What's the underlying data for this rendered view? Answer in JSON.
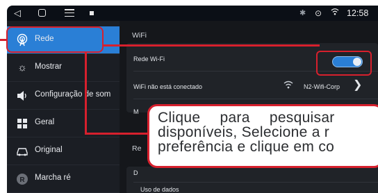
{
  "status_bar": {
    "back_icon": "triangle-back-icon",
    "home_icon": "square-home-icon",
    "menu_icon": "menu-icon",
    "bluetooth_icon": "bluetooth-icon",
    "location_icon": "location-pin-icon",
    "wifi_icon": "wifi-icon",
    "time": "12:58"
  },
  "sidebar": {
    "items": [
      {
        "label": "Rede",
        "icon": "wifi-antenna-icon",
        "active": true
      },
      {
        "label": "Mostrar",
        "icon": "sun-brightness-icon",
        "active": false
      },
      {
        "label": "Configuração de som",
        "icon": "speaker-icon",
        "active": false
      },
      {
        "label": "Geral",
        "icon": "grid-icon",
        "active": false
      },
      {
        "label": "Original",
        "icon": "car-icon",
        "active": false
      },
      {
        "label": "Marcha ré",
        "icon": "reverse-r-icon",
        "active": false
      }
    ]
  },
  "main": {
    "wifi_section_title": "WiFi",
    "wifi_toggle_label": "Rede Wi-Fi",
    "wifi_toggle_on": true,
    "connection_status": "WiFi não está conectado",
    "network_name": "N2-Wifi-Corp",
    "truncated_row_label": "M",
    "second_section_title": "Re",
    "second_card_row_label": "D",
    "data_usage_label": "Uso de dados"
  },
  "annotation": {
    "accent_color": "#d7202d",
    "callout_lines": [
      "Clique para pesquisar",
      "disponíveis, Selecione a r",
      "preferência e clique em co"
    ]
  }
}
